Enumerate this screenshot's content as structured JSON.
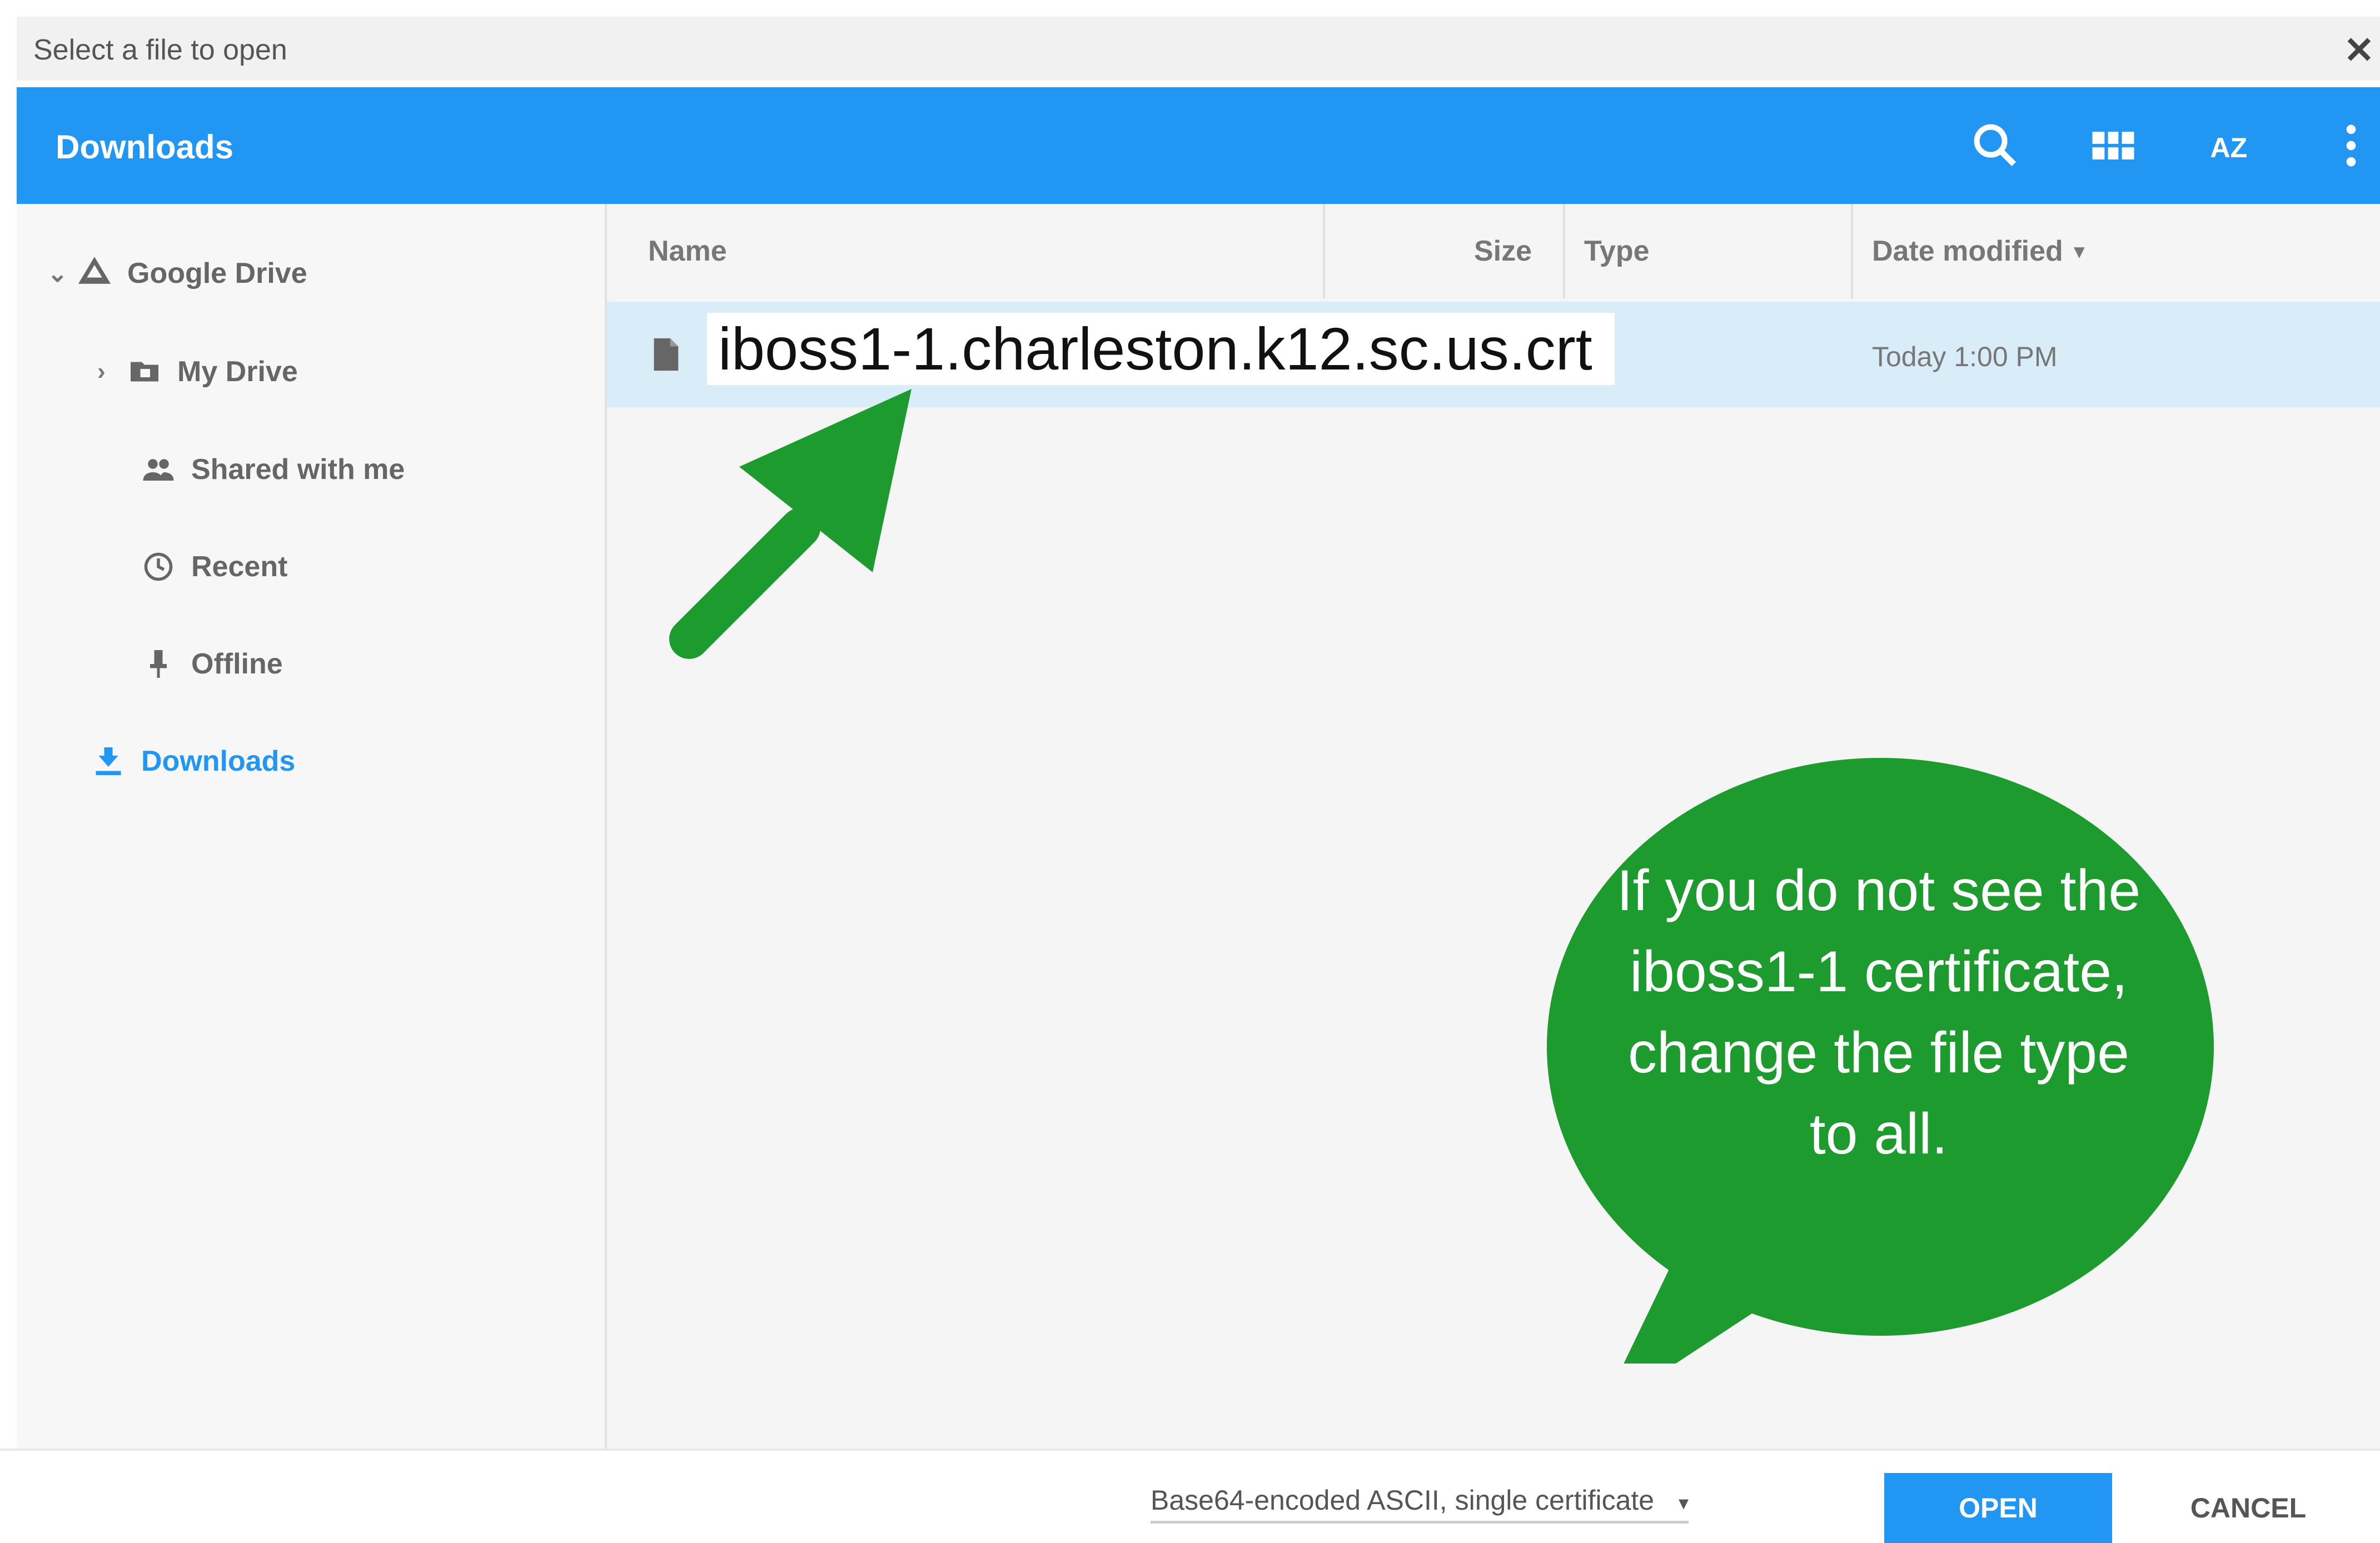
{
  "dialog": {
    "title": "Select a file to open",
    "close_glyph": "✕"
  },
  "header": {
    "location": "Downloads",
    "icons": [
      "search-icon",
      "grid-view-icon",
      "sort-az-icon",
      "more-vert-icon"
    ],
    "sort_label": "AZ"
  },
  "sidebar": {
    "items": [
      {
        "label": "Google Drive",
        "icon": "google-drive-icon"
      },
      {
        "label": "My Drive",
        "icon": "folder-icon"
      },
      {
        "label": "Shared with me",
        "icon": "people-icon"
      },
      {
        "label": "Recent",
        "icon": "clock-icon"
      },
      {
        "label": "Offline",
        "icon": "pin-icon"
      },
      {
        "label": "Downloads",
        "icon": "download-icon"
      }
    ]
  },
  "list": {
    "columns": {
      "name": "Name",
      "size": "Size",
      "type": "Type",
      "date": "Date modified"
    },
    "rows": [
      {
        "name": "iboss1-1.charleston.k12.sc.us.crt",
        "size": "",
        "type": "",
        "date": "Today 1:00 PM"
      }
    ]
  },
  "footer": {
    "filter": "Base64-encoded ASCII, single certificate",
    "open_label": "OPEN",
    "cancel_label": "CANCEL"
  },
  "annotation": {
    "callout_text": "If you do not see the iboss1-1 certificate, change the file type to all."
  },
  "colors": {
    "accent": "#2196f3",
    "selected_row": "#d9edf9",
    "callout_green": "#1e9b2e"
  }
}
